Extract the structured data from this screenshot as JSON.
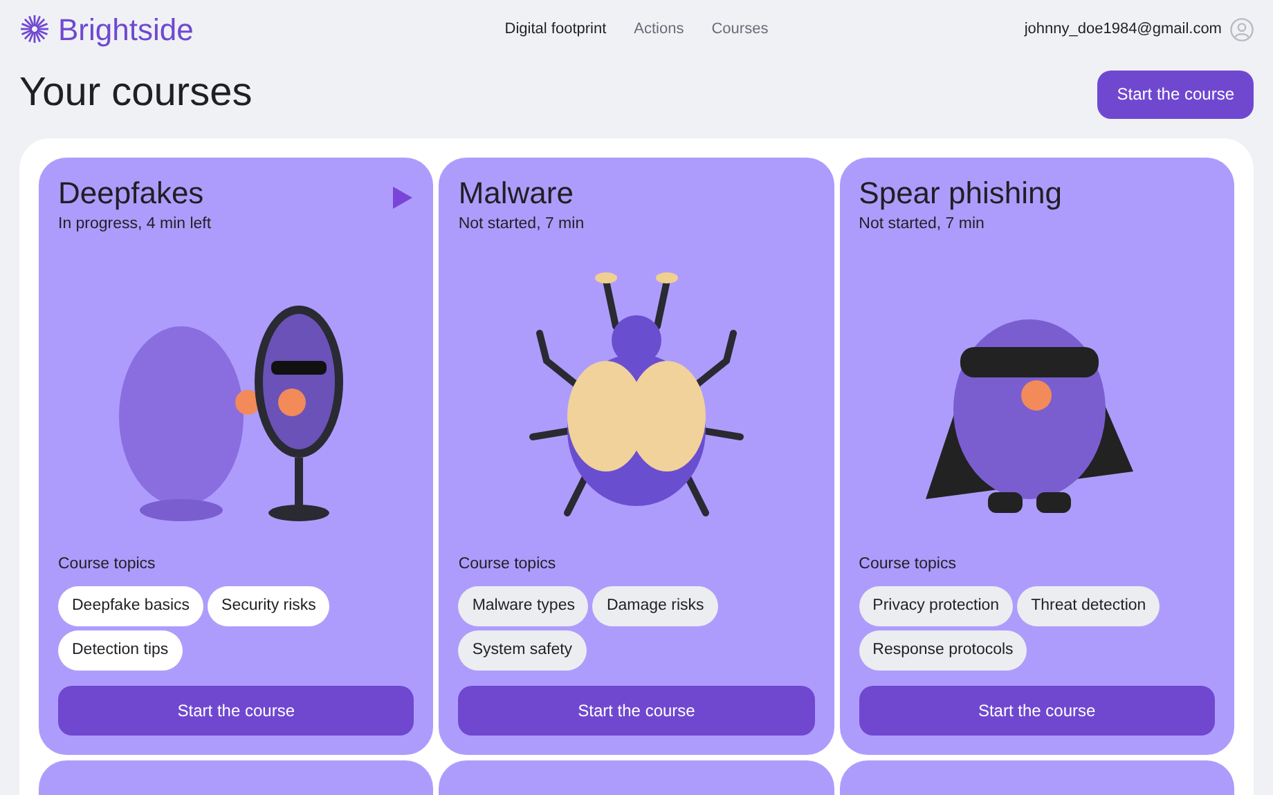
{
  "brand": {
    "name": "Brightside"
  },
  "nav": [
    {
      "label": "Digital footprint",
      "selected": true
    },
    {
      "label": "Actions",
      "selected": false
    },
    {
      "label": "Courses",
      "selected": false
    }
  ],
  "user": {
    "email": "johnny_doe1984@gmail.com"
  },
  "page_title": "Your courses",
  "header_button": "Start the course",
  "courses": [
    {
      "title": "Deepfakes",
      "status": "In progress, 4 min left",
      "in_progress": true,
      "kind": "mirror",
      "topics_label": "Course topics",
      "topics": [
        "Deepfake basics",
        "Security risks",
        "Detection tips"
      ],
      "button": "Start the course"
    },
    {
      "title": "Malware",
      "status": "Not started, 7 min",
      "in_progress": false,
      "kind": "bug",
      "topics_label": "Course topics",
      "topics": [
        "Malware types",
        "Damage risks",
        "System safety"
      ],
      "button": "Start the course"
    },
    {
      "title": "Spear phishing",
      "status": "Not started, 7 min",
      "in_progress": false,
      "kind": "masked",
      "topics_label": "Course topics",
      "topics": [
        "Privacy protection",
        "Threat detection",
        "Response protocols"
      ],
      "button": "Start the course"
    }
  ]
}
